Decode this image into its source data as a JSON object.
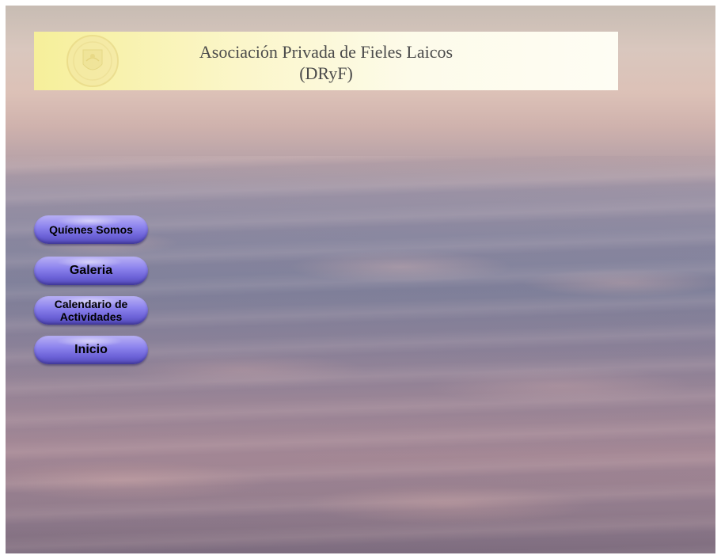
{
  "header": {
    "title_line1": "Asociación Privada de Fieles Laicos",
    "title_line2": "(DRyF)"
  },
  "nav": {
    "items": [
      {
        "label": "Quíenes Somos"
      },
      {
        "label": "Galeria"
      },
      {
        "label": "Calendario de Actividades"
      },
      {
        "label": "Inicio"
      }
    ]
  },
  "colors": {
    "header_bg": "#f6ef9a",
    "button_face": "#8d84ee",
    "title_text": "#4a4a4a"
  },
  "icons": {
    "logo": "emblem-seal"
  }
}
